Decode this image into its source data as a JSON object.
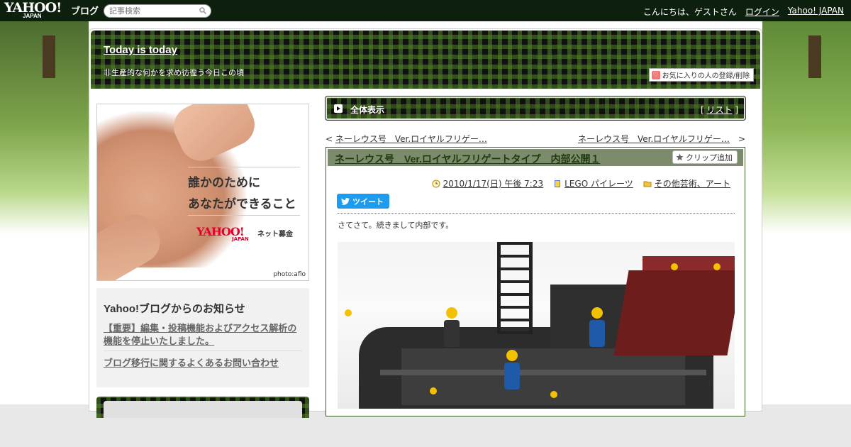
{
  "topbar": {
    "logo": "YAHOO!",
    "logo_sub": "JAPAN",
    "logo_blog": "ブログ",
    "search_placeholder": "記事検索",
    "greeting": "こんにちは、ゲストさん",
    "login": "ログイン",
    "yahoo_japan": "Yahoo! JAPAN"
  },
  "header": {
    "title": "Today is today",
    "description": "非生産的な何かを求め彷徨う今日この頃",
    "fav_button": "お気に入りの人の登録/削除"
  },
  "ad": {
    "line1": "誰かのために",
    "line2": "あなたができること",
    "logo": "YAHOO!",
    "logo_sub": "JAPAN",
    "donate": "ネット募金",
    "credit": "photo:aflo"
  },
  "notice": {
    "title": "Yahoo!ブログからのお知らせ",
    "item1": "【重要】編集・投稿機能およびアクセス解析の機能を停止いたしました。",
    "item2": "ブログ移行に関するよくあるお問い合わせ"
  },
  "allbar": {
    "label": "全体表示",
    "list_open": "[ ",
    "list": "リスト",
    "list_close": " ]"
  },
  "pager": {
    "prev_mark": "< ",
    "prev": "ネーレウス号　Ver.ロイヤルフリゲー…",
    "next": "ネーレウス号　Ver.ロイヤルフリゲー…",
    "next_mark": "　>"
  },
  "article": {
    "title": "ネーレウス号　Ver.ロイヤルフリゲートタイプ　内部公開１",
    "clip": "クリップ追加",
    "date": "2010/1/17(日) 午後 7:23",
    "category1": "LEGO パイレーツ",
    "category2": "その他芸術、アート",
    "tweet": "ツイート",
    "body": "さてさて。続きまして内部です。"
  }
}
